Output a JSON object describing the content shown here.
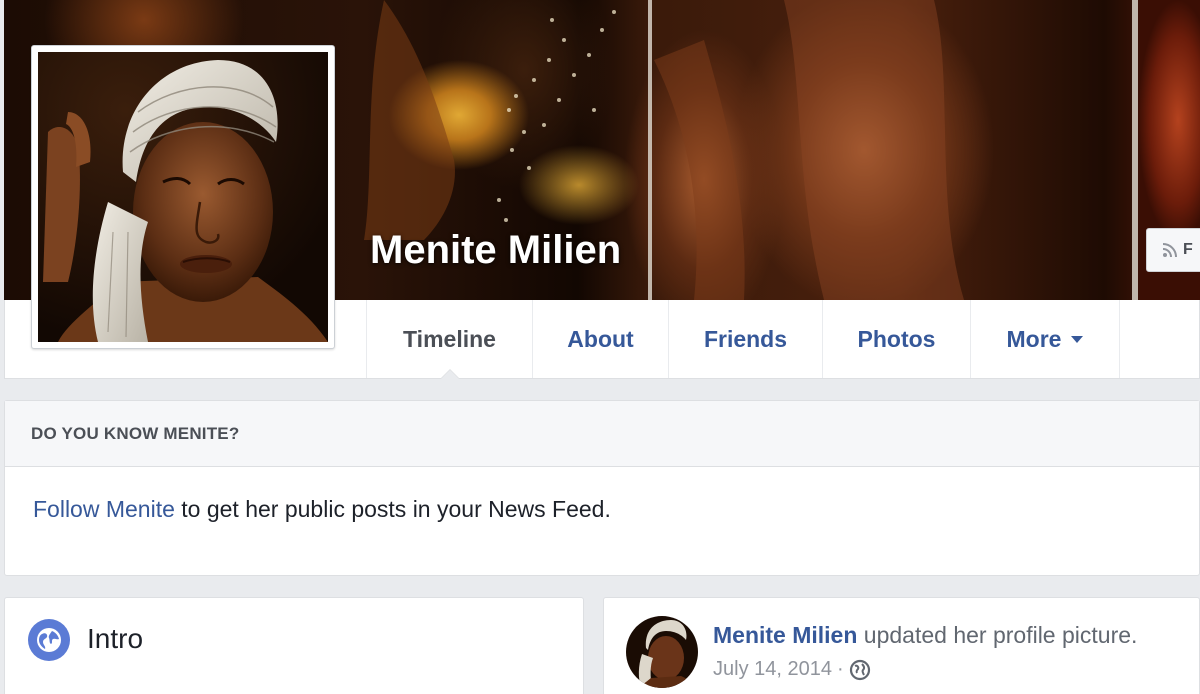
{
  "profile": {
    "name": "Menite Milien",
    "follow_button_label": "F"
  },
  "nav": {
    "tabs": [
      {
        "label": "Timeline",
        "active": true
      },
      {
        "label": "About"
      },
      {
        "label": "Friends"
      },
      {
        "label": "Photos"
      },
      {
        "label": "More",
        "has_caret": true
      }
    ]
  },
  "know_card": {
    "heading": "DO YOU KNOW MENITE?",
    "follow_link": "Follow Menite",
    "body_rest": " to get her public posts in your News Feed."
  },
  "intro": {
    "title": "Intro",
    "icon": "globe-icon"
  },
  "post": {
    "author": "Menite Milien",
    "action": " updated her profile picture.",
    "date": "July 14, 2014",
    "separator": "·",
    "privacy_icon": "globe-icon"
  },
  "colors": {
    "link_blue": "#365899",
    "page_bg": "#e9ebee",
    "header_bg": "#f6f7f9",
    "text_dark": "#1d2129",
    "text_grey": "#4b4f56",
    "meta_grey": "#90949c",
    "intro_icon_blue": "#5b7bd5"
  }
}
